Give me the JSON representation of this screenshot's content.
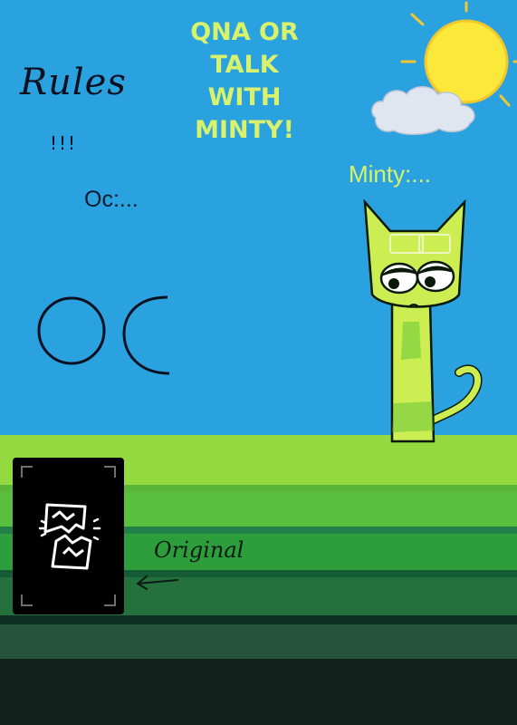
{
  "title": "QNA OR\nTALK\nWITH\nMINTY!",
  "rules_text": "Rules",
  "rules_exclaim": "!!!",
  "oc_label": "Oc:...",
  "oc_drawing_text": "OC",
  "minty_label": "Minty:...",
  "original_label": "Original",
  "colors": {
    "sky": "#2ba2e0",
    "title_yellow": "#d9f26a",
    "sun": "#fbe83a",
    "cat_green": "#cdee52"
  },
  "icons": {
    "image_placeholder": "broken-image-icon",
    "arrow": "arrow-left-icon",
    "sun": "sun-icon",
    "cloud": "cloud-icon"
  }
}
